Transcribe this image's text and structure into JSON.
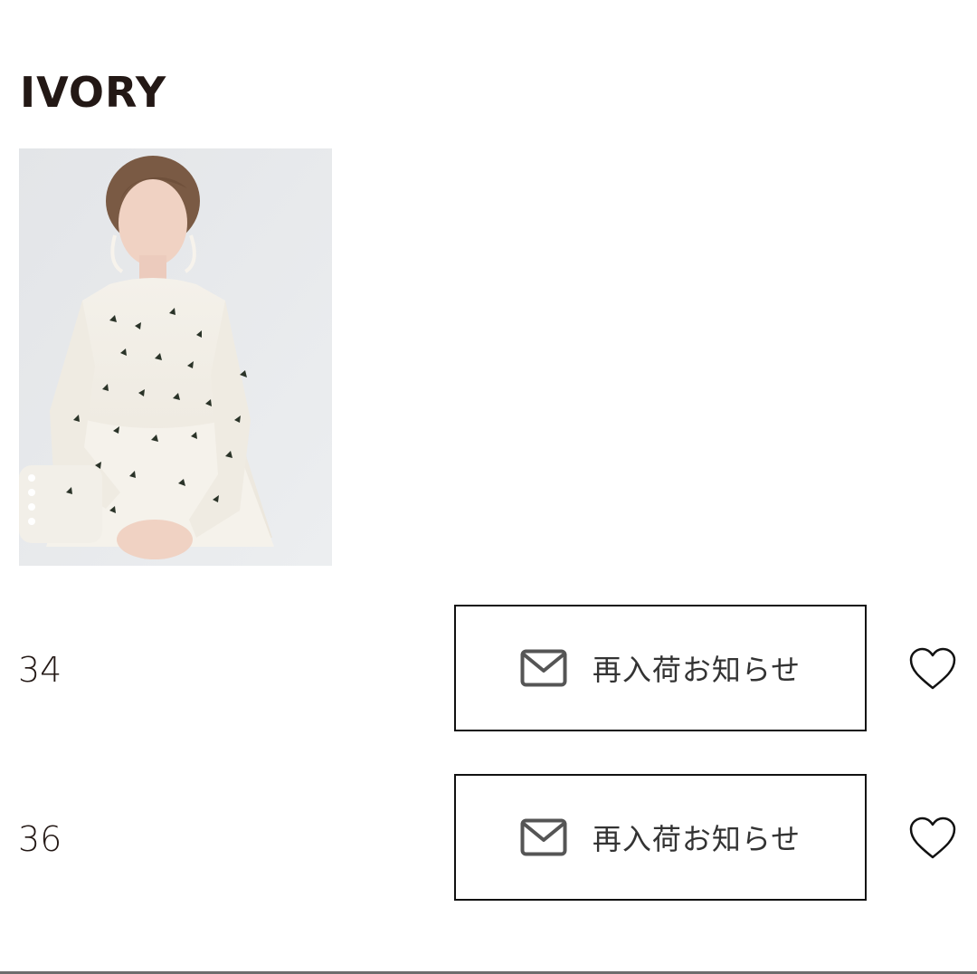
{
  "product": {
    "color_name": "IVORY"
  },
  "sizes": [
    {
      "size": "34",
      "notify_label": "再入荷お知らせ"
    },
    {
      "size": "36",
      "notify_label": "再入荷お知らせ"
    }
  ],
  "icons": {
    "notify": "mail-icon",
    "favorite": "heart-outline-icon"
  },
  "colors": {
    "text": "#231815",
    "button_border": "#111111",
    "photo_background": "#e8e9eb"
  }
}
